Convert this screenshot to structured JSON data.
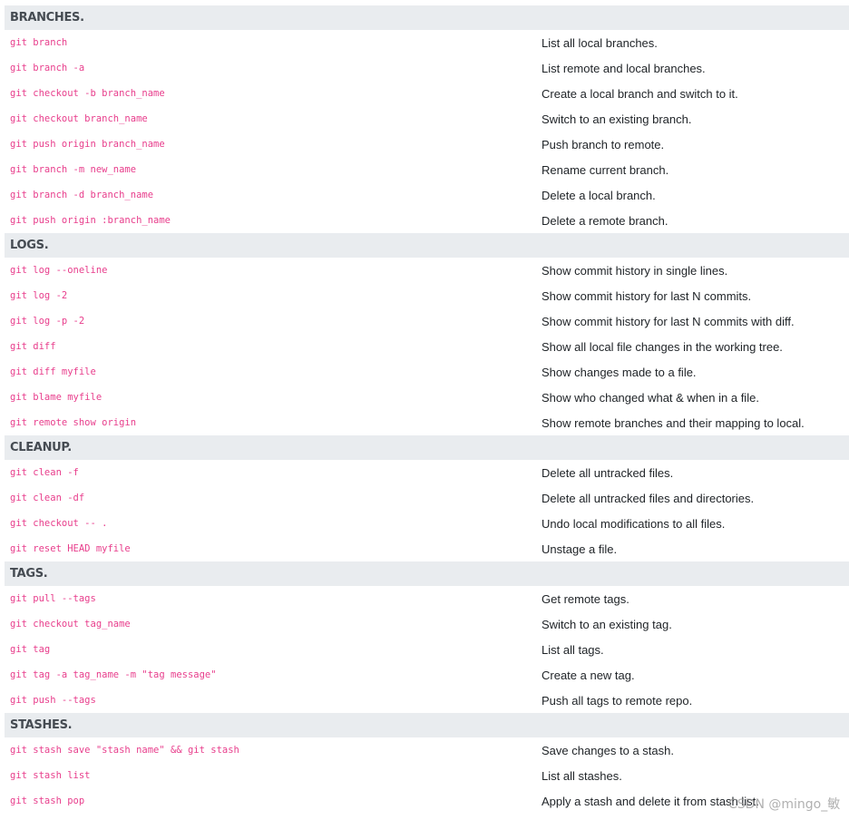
{
  "sections": [
    {
      "title": "BRANCHES.",
      "rows": [
        {
          "cmd": "git branch",
          "desc": "List all local branches."
        },
        {
          "cmd": "git branch -a",
          "desc": "List remote and local branches."
        },
        {
          "cmd": "git checkout -b branch_name",
          "desc": "Create a local branch and switch to it."
        },
        {
          "cmd": "git checkout branch_name",
          "desc": "Switch to an existing branch."
        },
        {
          "cmd": "git push origin branch_name",
          "desc": "Push branch to remote."
        },
        {
          "cmd": "git branch -m new_name",
          "desc": "Rename current branch."
        },
        {
          "cmd": "git branch -d branch_name",
          "desc": "Delete a local branch."
        },
        {
          "cmd": "git push origin :branch_name",
          "desc": "Delete a remote branch."
        }
      ]
    },
    {
      "title": "LOGS.",
      "rows": [
        {
          "cmd": "git log --oneline",
          "desc": "Show commit history in single lines."
        },
        {
          "cmd": "git log -2",
          "desc": "Show commit history for last N commits."
        },
        {
          "cmd": "git log -p -2",
          "desc": "Show commit history for last N commits with diff."
        },
        {
          "cmd": "git diff",
          "desc": "Show all local file changes in the working tree."
        },
        {
          "cmd": "git diff myfile",
          "desc": "Show changes made to a file."
        },
        {
          "cmd": "git blame myfile",
          "desc": "Show who changed what & when in a file."
        },
        {
          "cmd": "git remote show origin",
          "desc": "Show remote branches and their mapping to local."
        }
      ]
    },
    {
      "title": "CLEANUP.",
      "rows": [
        {
          "cmd": "git clean -f",
          "desc": "Delete all untracked files."
        },
        {
          "cmd": "git clean -df",
          "desc": "Delete all untracked files and directories."
        },
        {
          "cmd": "git checkout -- .",
          "desc": "Undo local modifications to all files."
        },
        {
          "cmd": "git reset HEAD myfile",
          "desc": "Unstage a file."
        }
      ]
    },
    {
      "title": "TAGS.",
      "rows": [
        {
          "cmd": "git pull --tags",
          "desc": "Get remote tags."
        },
        {
          "cmd": "git checkout tag_name",
          "desc": "Switch to an existing tag."
        },
        {
          "cmd": "git tag",
          "desc": "List all tags."
        },
        {
          "cmd": "git tag -a tag_name -m \"tag message\"",
          "desc": "Create a new tag."
        },
        {
          "cmd": "git push --tags",
          "desc": "Push all tags to remote repo."
        }
      ]
    },
    {
      "title": "STASHES.",
      "rows": [
        {
          "cmd": "git stash save \"stash name\" && git stash",
          "desc": "Save changes to a stash."
        },
        {
          "cmd": "git stash list",
          "desc": "List all stashes."
        },
        {
          "cmd": "git stash pop",
          "desc": "Apply a stash and delete it from stash list."
        }
      ]
    }
  ],
  "watermark": "CSDN @mingo_敏",
  "colors": {
    "command": "#e83e8c",
    "section_bg": "#e9ecef"
  }
}
